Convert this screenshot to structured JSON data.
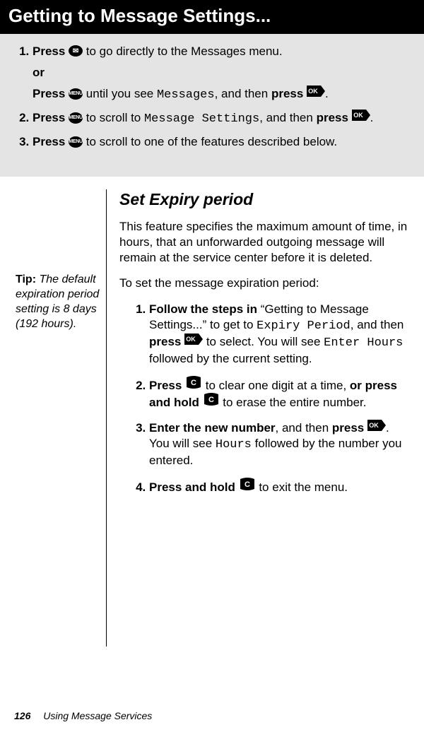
{
  "header": {
    "title": "Getting to Message Settings..."
  },
  "intro": {
    "step1a_press": "Press",
    "step1a_rest": " to go directly to the Messages menu.",
    "or": "or",
    "step1b_press": "Press",
    "step1b_mid": " until you see ",
    "step1b_lcd": "Messages",
    "step1b_mid2": ", and then ",
    "step1b_press2": "press",
    "step1b_end": ".",
    "step2_press": "Press",
    "step2_mid": " to scroll to ",
    "step2_lcd": "Message Settings",
    "step2_mid2": ", and then ",
    "step2_press2": "press",
    "step2_end": ".",
    "step3_press": "Press",
    "step3_rest": " to scroll to one of the features described below."
  },
  "tip": {
    "label": "Tip: ",
    "text": "The default expiration period setting is 8 days (192 hours)."
  },
  "section": {
    "title": "Set Expiry period",
    "para1": "This feature specifies the maximum amount of time, in hours, that an unforwarded outgoing message will remain at the service center before it is deleted.",
    "para2": "To set the message expiration period:",
    "s1_a": "Follow the steps in",
    "s1_b": " “Getting to Message Settings...” to get to ",
    "s1_lcd1": "Expiry Period",
    "s1_c": ", and then ",
    "s1_press": "press",
    "s1_d": " to select. You will see ",
    "s1_lcd2": "Enter Hours",
    "s1_e": " followed by the current setting.",
    "s2_press": "Press",
    "s2_a": " to clear one digit at a time, ",
    "s2_b": "or press and hold",
    "s2_c": " to erase the entire number.",
    "s3_a": "Enter the new number",
    "s3_b": ", and then ",
    "s3_press": "press",
    "s3_c": ". You will see ",
    "s3_lcd": "Hours",
    "s3_d": " followed by the number you entered.",
    "s4_a": "Press and hold",
    "s4_b": " to exit the menu."
  },
  "footer": {
    "page": "126",
    "chapter": "Using Message Services"
  },
  "icons": {
    "envelope": "✉",
    "menu": "MENU",
    "ok": "OK",
    "c": "C"
  }
}
